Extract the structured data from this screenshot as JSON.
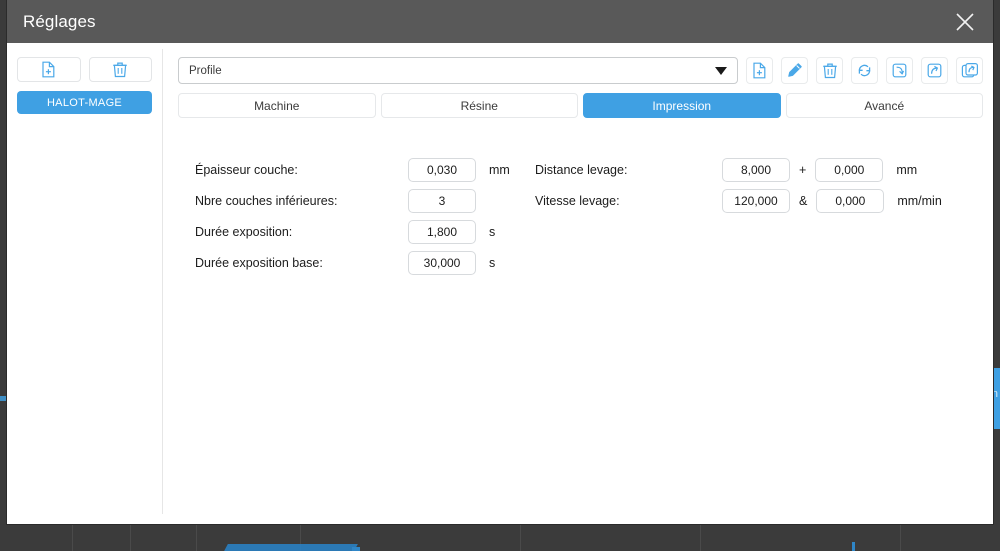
{
  "window": {
    "title": "Réglages",
    "close_icon": "close-icon"
  },
  "background": {
    "right_button_glyph": "n"
  },
  "sidebar": {
    "buttons": [
      {
        "name": "add-machine-button",
        "icon": "file-add-icon"
      },
      {
        "name": "delete-machine-button",
        "icon": "trash-icon"
      }
    ],
    "machines": [
      {
        "label": "HALOT-MAGE",
        "selected": true
      }
    ]
  },
  "profile": {
    "selected": "Profile",
    "caret_icon": "chevron-down-icon",
    "toolbar": [
      {
        "name": "new-profile-button",
        "icon": "file-add-icon"
      },
      {
        "name": "edit-profile-button",
        "icon": "pencil-icon"
      },
      {
        "name": "delete-profile-button",
        "icon": "trash-icon"
      },
      {
        "name": "reset-profile-button",
        "icon": "refresh-icon"
      },
      {
        "name": "import-profile-button",
        "icon": "import-arrow-icon"
      },
      {
        "name": "export-profile-button",
        "icon": "export-arrow-icon"
      },
      {
        "name": "duplicate-profile-button",
        "icon": "copy-export-icon"
      }
    ]
  },
  "tabs": [
    {
      "label": "Machine",
      "active": false
    },
    {
      "label": "Résine",
      "active": false
    },
    {
      "label": "Impression",
      "active": true
    },
    {
      "label": "Avancé",
      "active": false
    }
  ],
  "accent_color": "#3fa0e3",
  "titlebar_color": "#595959",
  "form": {
    "left": [
      {
        "label": "Épaisseur couche:",
        "value": "0,030",
        "unit": "mm"
      },
      {
        "label": "Nbre couches inférieures:",
        "value": "3",
        "unit": ""
      },
      {
        "label": "Durée exposition:",
        "value": "1,800",
        "unit": "s"
      },
      {
        "label": "Durée exposition base:",
        "value": "30,000",
        "unit": "s"
      }
    ],
    "right": [
      {
        "label": "Distance levage:",
        "value": "8,000",
        "separator": "+",
        "value2": "0,000",
        "unit": "mm"
      },
      {
        "label": "Vitesse levage:",
        "value": "120,000",
        "separator": "&",
        "value2": "0,000",
        "unit": "mm/min"
      }
    ]
  }
}
